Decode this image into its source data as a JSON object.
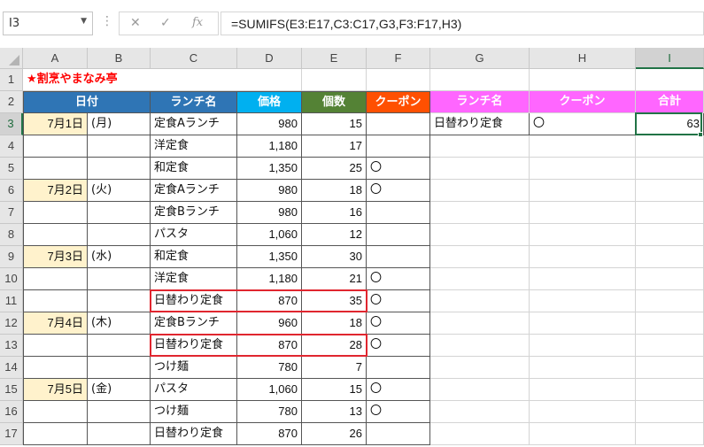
{
  "formula_bar": {
    "name_box": "I3",
    "cancel_icon": "✕",
    "enter_icon": "✓",
    "fx_label": "fx",
    "formula": "=SUMIFS(E3:E17,C3:C17,G3,F3:F17,H3)"
  },
  "columns": [
    "A",
    "B",
    "C",
    "D",
    "E",
    "F",
    "G",
    "H",
    "I"
  ],
  "rows": [
    "1",
    "2",
    "3",
    "4",
    "5",
    "6",
    "7",
    "8",
    "9",
    "10",
    "11",
    "12",
    "13",
    "14",
    "15",
    "16",
    "17"
  ],
  "selected_cell": "I3",
  "title": "★割烹やまなみ亭",
  "colors": {
    "date_header": "#2f75b5",
    "lunch_header": "#2f75b5",
    "price_header": "#00b0f0",
    "count_header": "#548235",
    "coupon_header": "#ff5001",
    "criteria_header": "#ff66ff",
    "date_fill": "#fff2cc",
    "title_text": "#ff0000",
    "highlight_border": "#e0262f",
    "selection": "#217346"
  },
  "headers": {
    "date": "日付",
    "lunch": "ランチ名",
    "price": "価格",
    "count": "個数",
    "coupon": "クーポン",
    "crit_lunch": "ランチ名",
    "crit_coupon": "クーポン",
    "total": "合計"
  },
  "data_rows": [
    {
      "date": "7月1日",
      "dow": "(月)",
      "lunch": "定食Aランチ",
      "price": "980",
      "count": "15",
      "coupon": ""
    },
    {
      "date": "",
      "dow": "",
      "lunch": "洋定食",
      "price": "1,180",
      "count": "17",
      "coupon": ""
    },
    {
      "date": "",
      "dow": "",
      "lunch": "和定食",
      "price": "1,350",
      "count": "25",
      "coupon": "〇"
    },
    {
      "date": "7月2日",
      "dow": "(火)",
      "lunch": "定食Aランチ",
      "price": "980",
      "count": "18",
      "coupon": "〇"
    },
    {
      "date": "",
      "dow": "",
      "lunch": "定食Bランチ",
      "price": "980",
      "count": "16",
      "coupon": ""
    },
    {
      "date": "",
      "dow": "",
      "lunch": "パスタ",
      "price": "1,060",
      "count": "12",
      "coupon": ""
    },
    {
      "date": "7月3日",
      "dow": "(水)",
      "lunch": "和定食",
      "price": "1,350",
      "count": "30",
      "coupon": ""
    },
    {
      "date": "",
      "dow": "",
      "lunch": "洋定食",
      "price": "1,180",
      "count": "21",
      "coupon": "〇"
    },
    {
      "date": "",
      "dow": "",
      "lunch": "日替わり定食",
      "price": "870",
      "count": "35",
      "coupon": "〇"
    },
    {
      "date": "7月4日",
      "dow": "(木)",
      "lunch": "定食Bランチ",
      "price": "960",
      "count": "18",
      "coupon": "〇"
    },
    {
      "date": "",
      "dow": "",
      "lunch": "日替わり定食",
      "price": "870",
      "count": "28",
      "coupon": "〇"
    },
    {
      "date": "",
      "dow": "",
      "lunch": "つけ麺",
      "price": "780",
      "count": "7",
      "coupon": ""
    },
    {
      "date": "7月5日",
      "dow": "(金)",
      "lunch": "パスタ",
      "price": "1,060",
      "count": "15",
      "coupon": "〇"
    },
    {
      "date": "",
      "dow": "",
      "lunch": "つけ麺",
      "price": "780",
      "count": "13",
      "coupon": "〇"
    },
    {
      "date": "",
      "dow": "",
      "lunch": "日替わり定食",
      "price": "870",
      "count": "26",
      "coupon": ""
    }
  ],
  "criteria": {
    "lunch": "日替わり定食",
    "coupon": "〇",
    "total": "63"
  }
}
